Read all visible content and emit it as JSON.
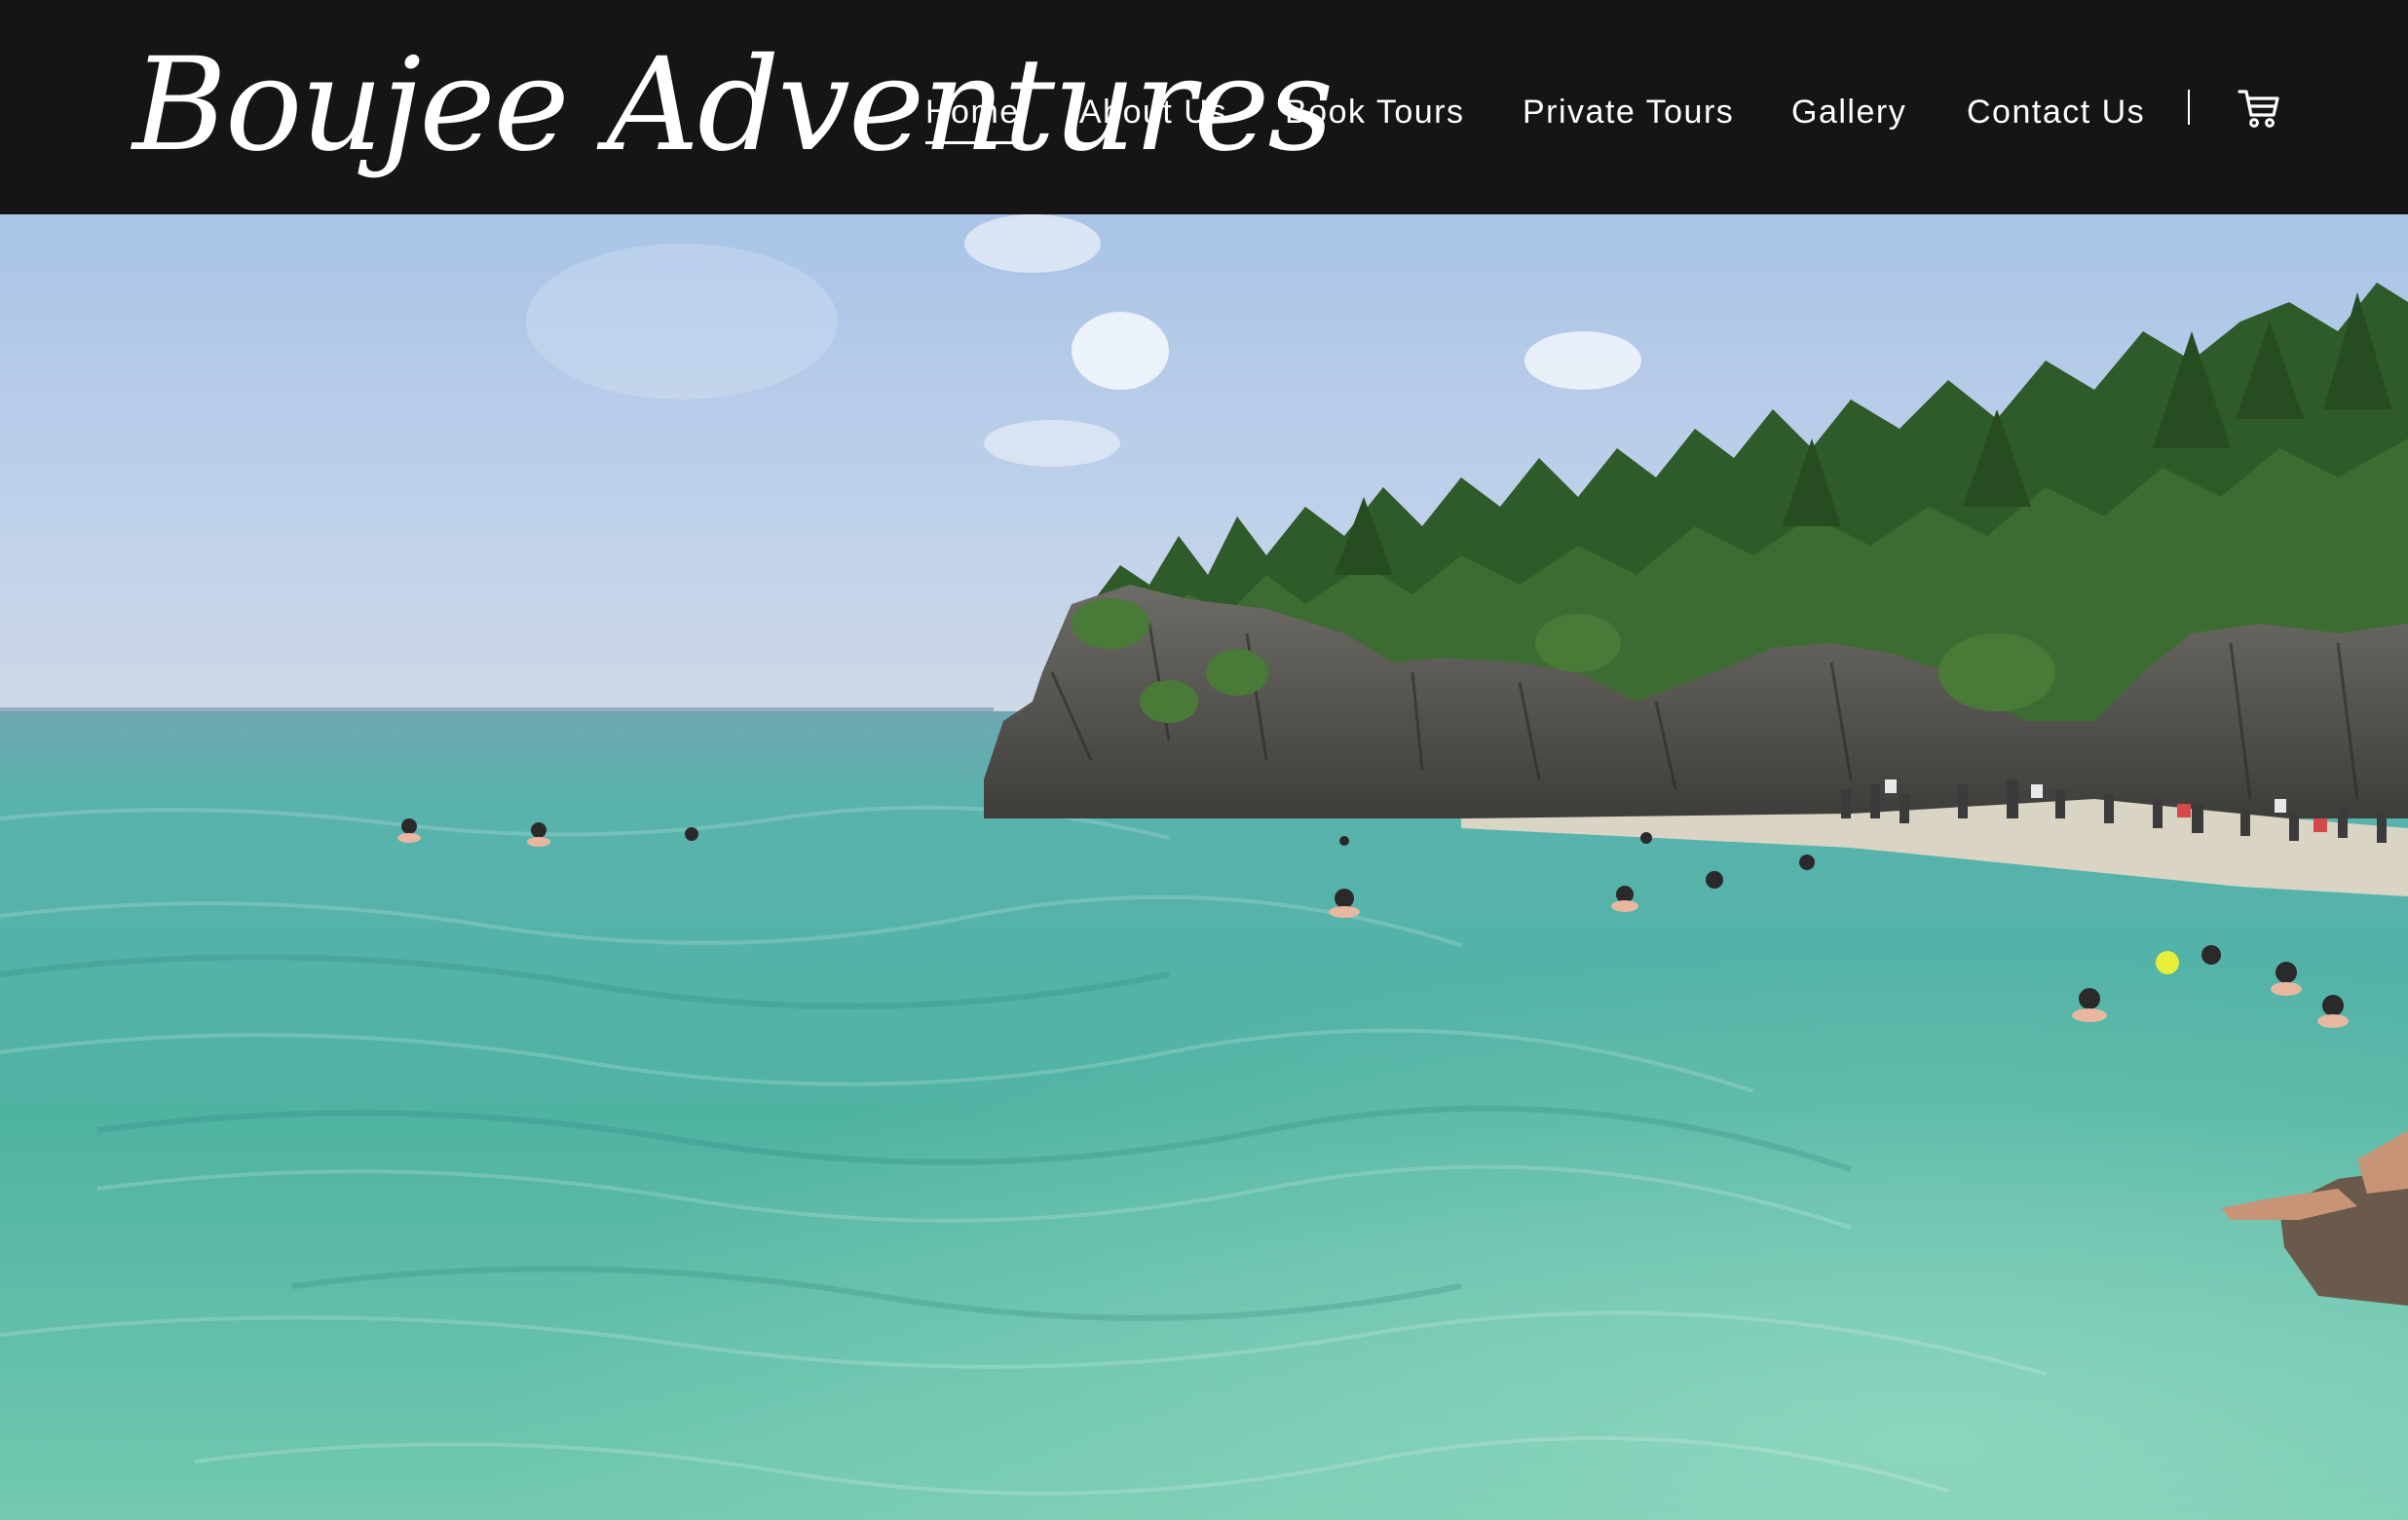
{
  "brand": {
    "logo_text": "Boujee Adventures"
  },
  "nav": {
    "items": [
      {
        "label": "Home",
        "active": true
      },
      {
        "label": "About Us",
        "active": false
      },
      {
        "label": "Book Tours",
        "active": false
      },
      {
        "label": "Private Tours",
        "active": false
      },
      {
        "label": "Gallery",
        "active": false
      },
      {
        "label": "Contact Us",
        "active": false
      }
    ],
    "cart_icon": "shopping-cart-icon"
  },
  "colors": {
    "header_bg": "#151515",
    "text": "#ffffff",
    "water": "#5fbaa7",
    "sky": "#b5cbe6"
  }
}
